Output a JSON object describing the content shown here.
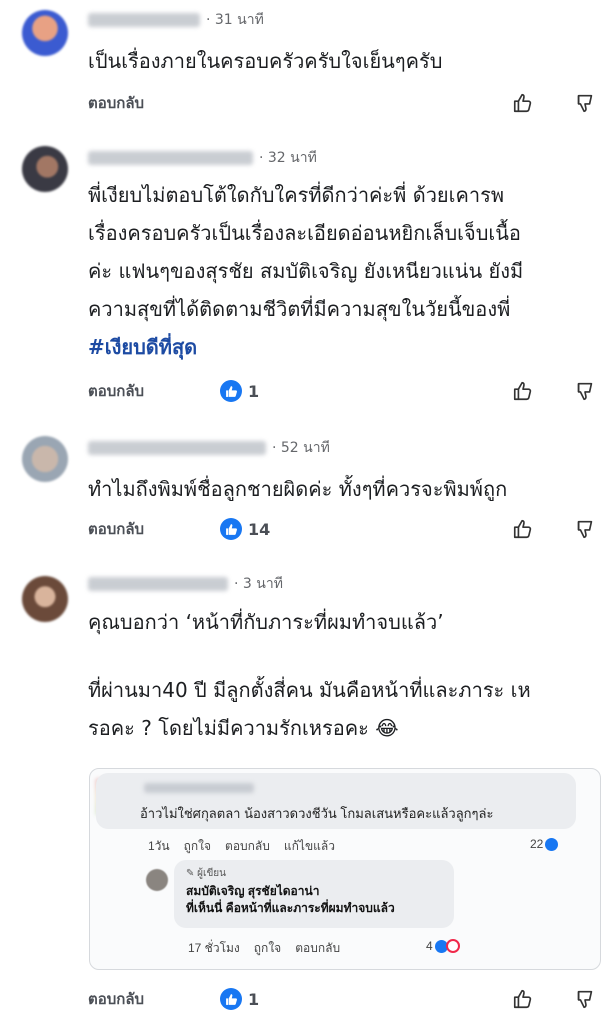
{
  "comments": [
    {
      "time": "· 31 นาที",
      "lines": [
        "เป็นเรื่องภายในครอบครัวครับใจเย็นๆครับ"
      ],
      "reply_label": "ตอบกลับ",
      "like_count": ""
    },
    {
      "time": "· 32 นาที",
      "lines": [
        "พี่เงียบไม่ตอบโต้ใดกับใครที่ดีกว่าค่ะพี่ ด้วยเคารพ",
        "เรื่องครอบครัวเป็นเรื่องละเอียดอ่อนหยิกเล็บเจ็บเนื้อ",
        "ค่ะ แฟนๆของสุรชัย สมบัติเจริญ ยังเหนียวแน่น ยังมี",
        "ความสุขที่ได้ติดตามชีวิตที่มีความสุขในวัยนี้ของพี่"
      ],
      "hashtag": "#เงียบดีที่สุด",
      "reply_label": "ตอบกลับ",
      "like_count": "1"
    },
    {
      "time": "· 52 นาที",
      "lines": [
        "ทำไมถึงพิมพ์ชื่อลูกชายผิดค่ะ ทั้งๆที่ควรจะพิมพ์ถูก"
      ],
      "reply_label": "ตอบกลับ",
      "like_count": "14"
    },
    {
      "time": "· 3 นาที",
      "lines": [
        "คุณบอกว่า ‘หน้าที่กับภาระที่ผมทำจบแล้ว’",
        "",
        " ที่ผ่านมา40 ปี มีลูกตั้งสี่คน มันคือหน้าที่และภาระ เห",
        "รอคะ ? โดยไม่มีความรักเหรอคะ 😂"
      ],
      "reply_label": "ตอบกลับ",
      "like_count": "1"
    }
  ],
  "embedded": {
    "comment_text": "อ้าวไม่ใช่ศกุลตลา น้องสาวดวงชีวัน โกมลเสนหรือคะแล้วลูกๆล่ะ",
    "meta": [
      "1วัน",
      "ถูกใจ",
      "ตอบกลับ",
      "แก้ไขแล้ว"
    ],
    "reaction_count": "22",
    "author_tag": "ผู้เขียน",
    "reply_name": "สมบัติเจริญ สุรชัยไดอาน่า",
    "reply_text": "ที่เห็นนี่ คือหน้าที่และภาระที่ผมทำจบแล้ว",
    "reply_meta": [
      "17 ชั่วโมง",
      "ถูกใจ",
      "ตอบกลับ"
    ],
    "reply_reaction_count": "4"
  },
  "colors": {
    "like_blue": "#1877f2",
    "hashtag": "#1d4ba3",
    "secondary_text": "#65676b",
    "love_red": "#f0284a"
  },
  "icons": [
    "thumbs-up-icon",
    "thumbs-down-icon",
    "like-badge-icon",
    "pencil-icon"
  ]
}
